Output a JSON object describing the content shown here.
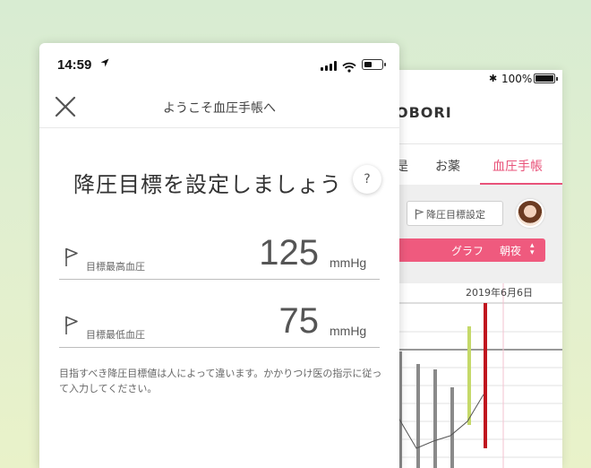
{
  "back_screen": {
    "status": {
      "bluetooth": "✱",
      "battery_percent": "100%"
    },
    "brand": "OBORI",
    "tabs": [
      {
        "label": "是"
      },
      {
        "label": "お薬"
      },
      {
        "label": "血圧手帳"
      }
    ],
    "active_tab_color": "#e8537a",
    "goal_button_label": "降圧目標設定",
    "filter_bar": {
      "graph_label": "グラフ",
      "mode_label": "朝夜",
      "color": "#ef5a7e"
    },
    "chart_date": "2019年6月6日"
  },
  "modal": {
    "status_bar": {
      "time": "14:59",
      "location_icon": "location-arrow-icon"
    },
    "title": "ようこそ血圧手帳へ",
    "headline": "降圧目標を設定しましょう",
    "help_label": "?",
    "targets": [
      {
        "label": "目標最高血圧",
        "value": "125",
        "unit": "mmHg"
      },
      {
        "label": "目標最低血圧",
        "value": "75",
        "unit": "mmHg"
      }
    ],
    "note": "目指すべき降圧目標値は人によって違います。かかりつけ医の指示に従って入力してください。"
  }
}
